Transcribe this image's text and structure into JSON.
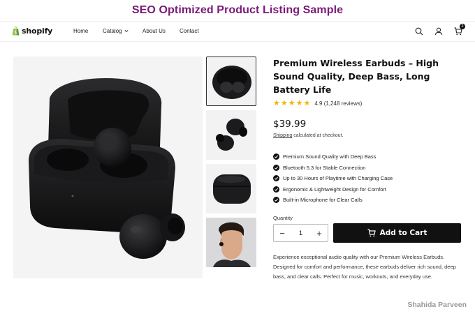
{
  "banner": {
    "title": "SEO Optimized Product Listing Sample"
  },
  "header": {
    "logo_text": "shopify",
    "nav": [
      {
        "label": "Home"
      },
      {
        "label": "Catalog",
        "has_dropdown": true
      },
      {
        "label": "About Us"
      },
      {
        "label": "Contact"
      }
    ],
    "icons": [
      "search-icon",
      "account-icon",
      "cart-icon"
    ],
    "cart_count": "2"
  },
  "gallery": {
    "thumbnails": [
      "case-open-top-view",
      "loose-earbuds",
      "case-closed",
      "model-wearing-earbud"
    ],
    "selected_index": 0
  },
  "product": {
    "title": "Premium Wireless Earbuds – High Sound Quality, Deep Bass, Long Battery Life",
    "rating_stars": 5,
    "rating_text": "4.9 (1,248 reviews)",
    "price": "$39.99",
    "shipping_prefix": "Shipping",
    "shipping_suffix": " calculated at checkout.",
    "features": [
      "Premium Sound Quality with Deep Bass",
      "Bluetooth 5.3 for Stable Connection",
      "Up to 30 Hours of Playtime with Charging Case",
      "Ergonomic & Lightweight Design for Comfort",
      "Built-in Microphone for Clear Calls"
    ],
    "quantity_label": "Quantity",
    "quantity_value": "1",
    "minus_symbol": "−",
    "plus_symbol": "+",
    "add_to_cart_label": "Add to Cart",
    "description": "Experience exceptional audio quality with our Premium Wireless Earbuds. Designed for comfort and performance, these earbuds deliver rich sound, deep bass, and clear calls. Perfect for music, workouts, and everyday use."
  },
  "watermark": "Shahida Parveen",
  "colors": {
    "banner": "#7a1a78",
    "star": "#f5b301",
    "button": "#111111"
  }
}
